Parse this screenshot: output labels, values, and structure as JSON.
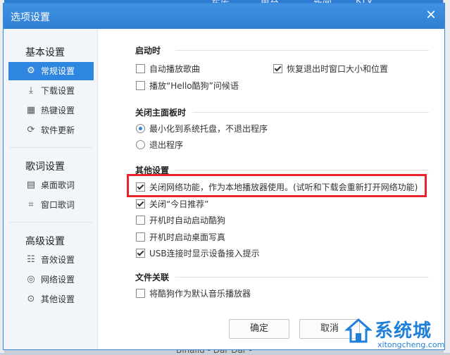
{
  "dialog": {
    "title": "选项设置"
  },
  "sidebar": {
    "groups": [
      {
        "title": "基本设置",
        "items": [
          {
            "label": "常规设置",
            "icon": "gear-icon"
          },
          {
            "label": "下载设置",
            "icon": "download-icon"
          },
          {
            "label": "热键设置",
            "icon": "keyboard-icon"
          },
          {
            "label": "软件更新",
            "icon": "refresh-icon"
          }
        ]
      },
      {
        "title": "歌词设置",
        "items": [
          {
            "label": "桌面歌词",
            "icon": "desktop-lyrics-icon"
          },
          {
            "label": "窗口歌词",
            "icon": "window-lyrics-icon"
          }
        ]
      },
      {
        "title": "高级设置",
        "items": [
          {
            "label": "音效设置",
            "icon": "equalizer-icon"
          },
          {
            "label": "网络设置",
            "icon": "network-icon"
          },
          {
            "label": "其他设置",
            "icon": "more-icon"
          }
        ]
      }
    ]
  },
  "sections": {
    "startup": {
      "title": "启动时",
      "autoplay": "自动播放歌曲",
      "restore": "恢复退出时窗口大小和位置",
      "greeting": "播放“Hello酷狗”问候语"
    },
    "close": {
      "title": "关闭主面板时",
      "minimize": "最小化到系统托盘，不退出程序",
      "exit": "退出程序"
    },
    "other": {
      "title": "其他设置",
      "network_off": "关闭网络功能，作为本地播放器使用。(试听和下载会重新打开网络功能)",
      "today_rec": "关闭“今日推荐”",
      "autostart": "开机时自动启动酷狗",
      "desktop_photo": "开机时启动桌面写真",
      "usb_hint": "USB连接时显示设备接入提示"
    },
    "assoc": {
      "title": "文件关联",
      "default_player": "将酷狗作为默认音乐播放器"
    }
  },
  "buttons": {
    "ok": "确定",
    "cancel": "取消"
  },
  "watermark": {
    "brand": "系统城",
    "url": "xitongcheng.com"
  },
  "background": {
    "menu1": "车库",
    "menu2": "电台",
    "menu3": "新闻",
    "menu4": "KTV",
    "song": "Binaiid - Dar Dar -"
  },
  "colors": {
    "accent": "#2f86e0",
    "highlight": "#e8232b"
  }
}
